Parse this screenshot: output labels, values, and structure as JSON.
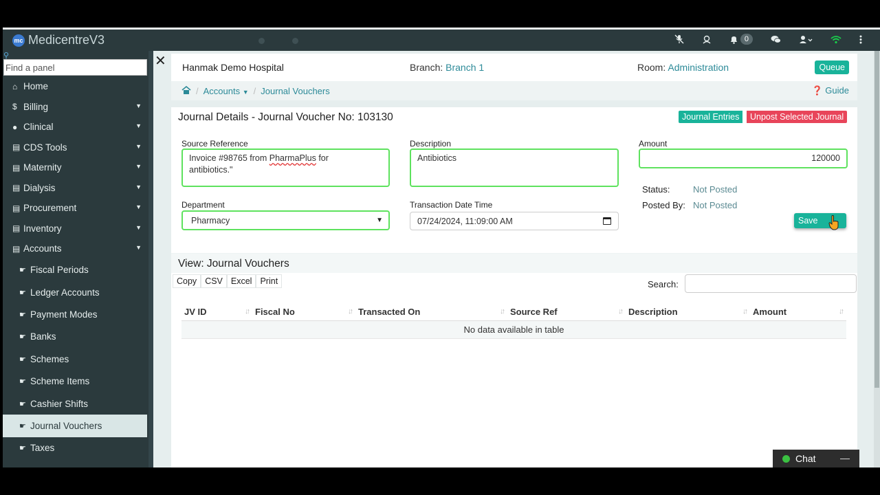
{
  "app": {
    "title": "MedicentreV3",
    "logo_text": "mc"
  },
  "topbar": {
    "notifications_count": "0"
  },
  "sidebar": {
    "search_placeholder": "Find a panel",
    "items": [
      {
        "label": "Home",
        "icon": "home-icon",
        "glyph": "⌂"
      },
      {
        "label": "Billing",
        "icon": "dollar-icon",
        "glyph": "$"
      },
      {
        "label": "Clinical",
        "icon": "user-icon",
        "glyph": "●"
      },
      {
        "label": "CDS Tools",
        "icon": "document-icon",
        "glyph": "▤"
      },
      {
        "label": "Maternity",
        "icon": "document-icon",
        "glyph": "▤"
      },
      {
        "label": "Dialysis",
        "icon": "document-icon",
        "glyph": "▤"
      },
      {
        "label": "Procurement",
        "icon": "document-icon",
        "glyph": "▤"
      },
      {
        "label": "Inventory",
        "icon": "document-icon",
        "glyph": "▤"
      },
      {
        "label": "Accounts",
        "icon": "document-icon",
        "glyph": "▤"
      }
    ],
    "sub_items": [
      {
        "label": "Fiscal Periods"
      },
      {
        "label": "Ledger Accounts"
      },
      {
        "label": "Payment Modes"
      },
      {
        "label": "Banks"
      },
      {
        "label": "Schemes"
      },
      {
        "label": "Scheme Items"
      },
      {
        "label": "Cashier Shifts"
      },
      {
        "label": "Journal Vouchers",
        "active": true
      },
      {
        "label": "Taxes"
      }
    ]
  },
  "header": {
    "hospital": "Hanmak Demo Hospital",
    "branch_label": "Branch:",
    "branch_value": "Branch 1",
    "room_label": "Room:",
    "room_value": "Administration",
    "queue_label": "Queue"
  },
  "breadcrumb": {
    "accounts": "Accounts",
    "current": "Journal Vouchers",
    "guide": "Guide"
  },
  "form": {
    "title": "Journal Details - Journal Voucher No: 103130",
    "journal_entries_label": "Journal Entries",
    "unpost_label": "Unpost Selected Journal",
    "source_reference_label": "Source Reference",
    "source_reference_pre": "Invoice #98765 from ",
    "source_reference_word": "PharmaPlus",
    "source_reference_post": " for",
    "source_reference_line2": "antibiotics.\"",
    "description_label": "Description",
    "description_value": "Antibiotics",
    "amount_label": "Amount",
    "amount_value": "120000",
    "department_label": "Department",
    "department_value": "Pharmacy",
    "txn_label": "Transaction Date Time",
    "txn_value": "07/24/2024, 11:09:00 AM",
    "status_label": "Status:",
    "status_value": "Not Posted",
    "posted_by_label": "Posted By:",
    "posted_by_value": "Not Posted",
    "save_label": "Save"
  },
  "table_section": {
    "title": "View: Journal Vouchers",
    "buttons": [
      "Copy",
      "CSV",
      "Excel",
      "Print"
    ],
    "search_label": "Search:",
    "columns": [
      "JV ID",
      "Fiscal No",
      "Transacted On",
      "Source Ref",
      "Description",
      "Amount"
    ],
    "empty_text": "No data available in table"
  },
  "chat": {
    "label": "Chat"
  }
}
